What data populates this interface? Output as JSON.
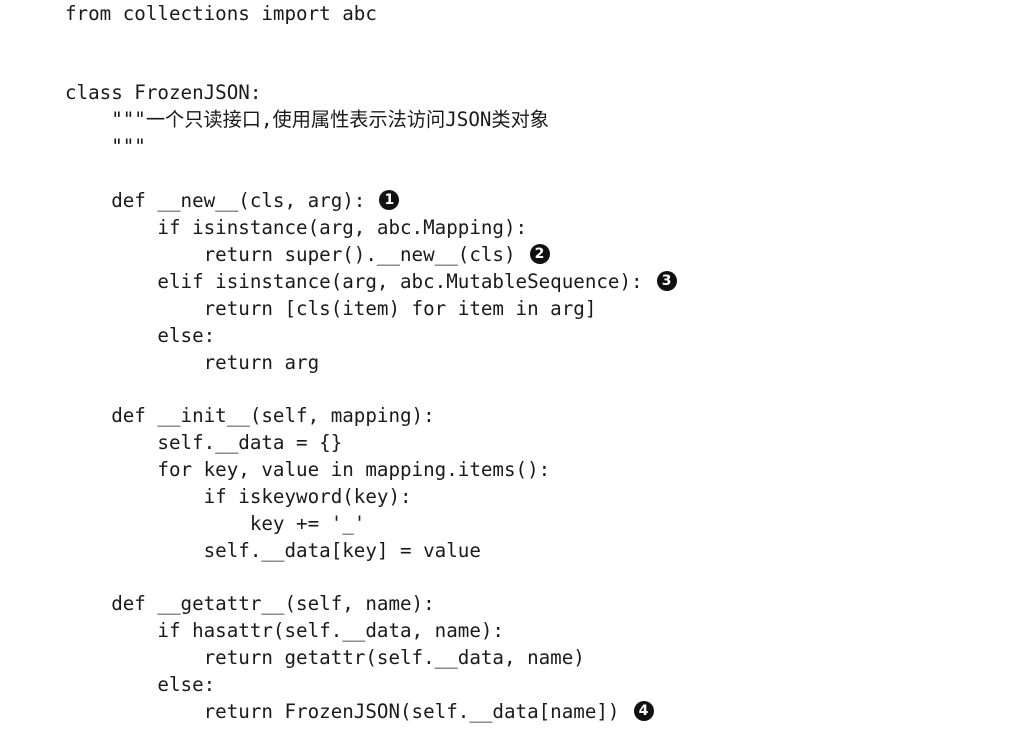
{
  "code": {
    "lines": [
      {
        "text": "from collections import abc",
        "callout": ""
      },
      {
        "text": "",
        "callout": ""
      },
      {
        "text": "",
        "callout": ""
      },
      {
        "text": "class FrozenJSON:",
        "callout": ""
      },
      {
        "text": "    \"\"\"一个只读接口,使用属性表示法访问JSON类对象",
        "callout": ""
      },
      {
        "text": "    \"\"\"",
        "callout": ""
      },
      {
        "text": "",
        "callout": ""
      },
      {
        "text": "    def __new__(cls, arg):",
        "callout": "1"
      },
      {
        "text": "        if isinstance(arg, abc.Mapping):",
        "callout": ""
      },
      {
        "text": "            return super().__new__(cls)",
        "callout": "2"
      },
      {
        "text": "        elif isinstance(arg, abc.MutableSequence):",
        "callout": "3"
      },
      {
        "text": "            return [cls(item) for item in arg]",
        "callout": ""
      },
      {
        "text": "        else:",
        "callout": ""
      },
      {
        "text": "            return arg",
        "callout": ""
      },
      {
        "text": "",
        "callout": ""
      },
      {
        "text": "    def __init__(self, mapping):",
        "callout": ""
      },
      {
        "text": "        self.__data = {}",
        "callout": ""
      },
      {
        "text": "        for key, value in mapping.items():",
        "callout": ""
      },
      {
        "text": "            if iskeyword(key):",
        "callout": ""
      },
      {
        "text": "                key += '_'",
        "callout": ""
      },
      {
        "text": "            self.__data[key] = value",
        "callout": ""
      },
      {
        "text": "",
        "callout": ""
      },
      {
        "text": "    def __getattr__(self, name):",
        "callout": ""
      },
      {
        "text": "        if hasattr(self.__data, name):",
        "callout": ""
      },
      {
        "text": "            return getattr(self.__data, name)",
        "callout": ""
      },
      {
        "text": "        else:",
        "callout": ""
      },
      {
        "text": "            return FrozenJSON(self.__data[name])",
        "callout": "4"
      }
    ]
  }
}
